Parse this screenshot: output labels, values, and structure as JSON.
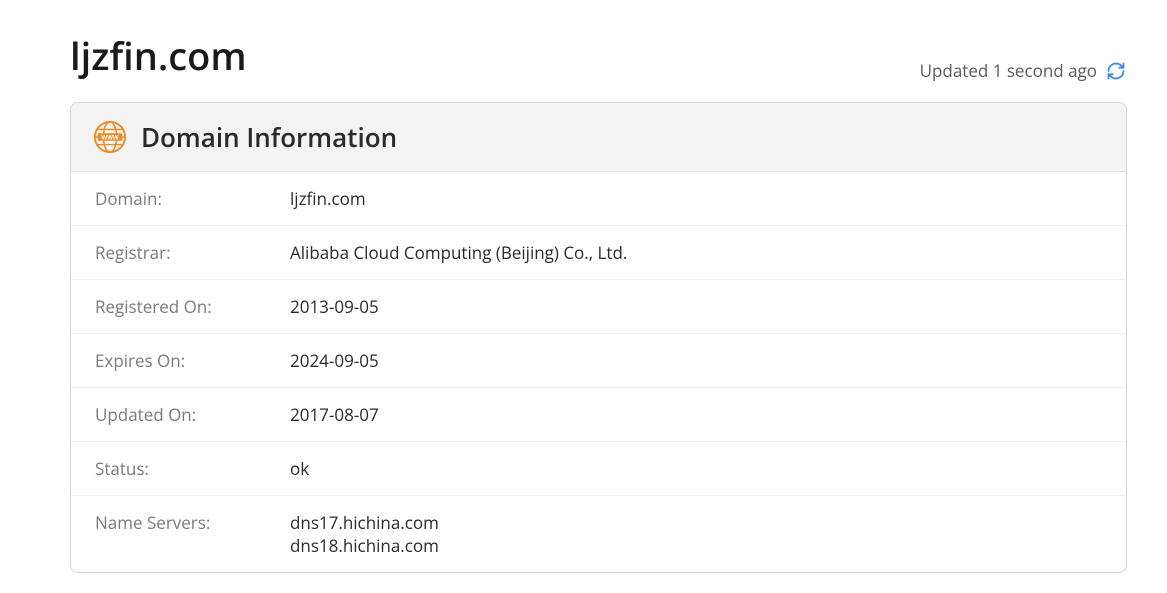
{
  "header": {
    "title": "ljzfin.com",
    "updated_text": "Updated 1 second ago"
  },
  "card": {
    "title": "Domain Information",
    "rows": [
      {
        "label": "Domain:",
        "value": "ljzfin.com"
      },
      {
        "label": "Registrar:",
        "value": "Alibaba Cloud Computing (Beijing) Co., Ltd."
      },
      {
        "label": "Registered On:",
        "value": "2013-09-05"
      },
      {
        "label": "Expires On:",
        "value": "2024-09-05"
      },
      {
        "label": "Updated On:",
        "value": "2017-08-07"
      },
      {
        "label": "Status:",
        "value": "ok"
      },
      {
        "label": "Name Servers:",
        "value": "dns17.hichina.com\ndns18.hichina.com"
      }
    ]
  }
}
